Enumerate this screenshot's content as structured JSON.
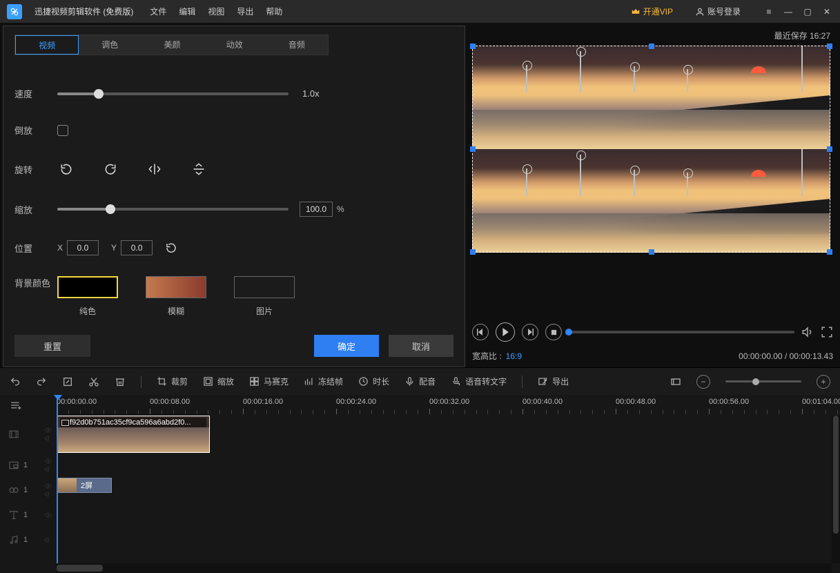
{
  "app": {
    "title": "迅捷视频剪辑软件 (免费版)"
  },
  "menu": {
    "file": "文件",
    "edit": "编辑",
    "view": "视图",
    "export": "导出",
    "help": "帮助"
  },
  "header": {
    "vip": "开通VIP",
    "login": "账号登录",
    "last_save_label": "最近保存",
    "last_save_time": "16:27"
  },
  "panel": {
    "tabs": {
      "video": "视频",
      "color": "调色",
      "beauty": "美颜",
      "fx": "动效",
      "audio": "音频"
    },
    "speed": {
      "label": "速度",
      "value": "1.0x",
      "percent": 18
    },
    "reverse": {
      "label": "倒放",
      "checked": false
    },
    "rotate": {
      "label": "旋转"
    },
    "scale": {
      "label": "缩放",
      "value": "100.0",
      "percent": 23,
      "unit": "%"
    },
    "position": {
      "label": "位置",
      "x_label": "X",
      "y_label": "Y",
      "x": "0.0",
      "y": "0.0"
    },
    "bg": {
      "label": "背景颜色",
      "solid": "纯色",
      "blur": "模糊",
      "image": "图片"
    },
    "buttons": {
      "reset": "重置",
      "ok": "确定",
      "cancel": "取消"
    }
  },
  "preview": {
    "aspect_label": "宽高比 :",
    "aspect_value": "16:9",
    "time_current": "00:00:00.00",
    "time_total": "00:00:13.43"
  },
  "toolbar": {
    "crop": "裁剪",
    "zoom": "缩放",
    "mosaic": "马赛克",
    "freeze": "冻结帧",
    "duration": "时长",
    "dub": "配音",
    "stt": "语音转文字",
    "export": "导出"
  },
  "timeline": {
    "ticks": [
      "00:00:00.00",
      "00:00:08.00",
      "00:00:16.00",
      "00:00:24.00",
      "00:00:32.00",
      "00:00:40.00",
      "00:00:48.00",
      "00:00:56.00",
      "00:01:04.00"
    ],
    "clip_name": "f92d0b751ac35cf9ca596a6abd2f0...",
    "clip2_label": "2屏"
  }
}
